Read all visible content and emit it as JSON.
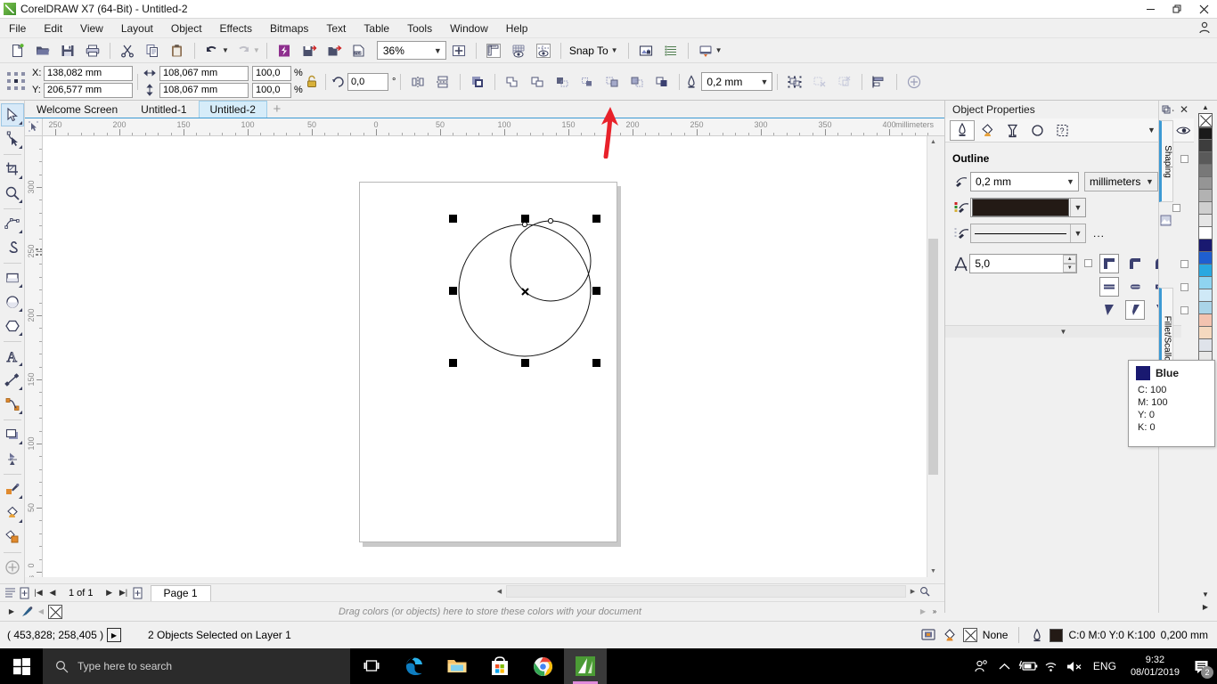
{
  "window": {
    "title": "CorelDRAW X7 (64-Bit) - Untitled-2",
    "minimize": "–",
    "restore": "❐",
    "close": "✕"
  },
  "menubar": {
    "items": [
      {
        "label": "File",
        "accel": "F"
      },
      {
        "label": "Edit",
        "accel": "E"
      },
      {
        "label": "View",
        "accel": "V"
      },
      {
        "label": "Layout",
        "accel": "L"
      },
      {
        "label": "Object",
        "accel": "O"
      },
      {
        "label": "Effects",
        "accel": "c"
      },
      {
        "label": "Bitmaps",
        "accel": "B"
      },
      {
        "label": "Text",
        "accel": "T"
      },
      {
        "label": "Table",
        "accel": "T"
      },
      {
        "label": "Tools",
        "accel": "o"
      },
      {
        "label": "Window",
        "accel": "W"
      },
      {
        "label": "Help",
        "accel": "H"
      }
    ],
    "account_icon": "user-account-icon"
  },
  "standard_toolbar": {
    "buttons": [
      {
        "name": "new-document-button",
        "icon": "new-document-icon"
      },
      {
        "name": "open-button",
        "icon": "open-folder-icon"
      },
      {
        "name": "save-button",
        "icon": "floppy-save-icon"
      },
      {
        "name": "print-button",
        "icon": "printer-icon"
      },
      {
        "name": "cut-button",
        "icon": "scissors-icon"
      },
      {
        "name": "copy-button",
        "icon": "copy-icon"
      },
      {
        "name": "paste-button",
        "icon": "paste-icon"
      },
      {
        "name": "undo-button",
        "icon": "undo-arrow-icon"
      },
      {
        "name": "redo-button",
        "icon": "redo-arrow-icon"
      },
      {
        "name": "import-corel-button",
        "icon": "corel-connect-icon"
      },
      {
        "name": "import-button",
        "icon": "import-icon"
      },
      {
        "name": "export-button",
        "icon": "export-icon"
      },
      {
        "name": "publish-pdf-button",
        "icon": "pdf-export-icon"
      }
    ],
    "zoom_level": "36%",
    "full_screen_label": "full-screen-preview-icon",
    "show_rulers_label": "show-rulers-icon",
    "show_grid_label": "show-grid-icon",
    "show_guides_label": "show-guides-icon",
    "snap_to_label": "Snap To",
    "options_label": "options-icon",
    "object_manager_label": "object-manager-icon",
    "app_launcher_label": "application-launcher-icon"
  },
  "property_bar": {
    "anchor_label": "object-origin-anchor",
    "x_label": "X:",
    "x_value": "138,082 mm",
    "y_label": "Y:",
    "y_value": "206,577 mm",
    "width_value": "108,067 mm",
    "height_value": "108,067 mm",
    "scale_x": "100,0",
    "scale_y": "100,0",
    "percent": "%",
    "lock_ratio_icon": "lock-ratio-icon",
    "rotate_value": "0,0",
    "degree_symbol": "°",
    "mirror_h_icon": "mirror-horizontal-icon",
    "mirror_v_icon": "mirror-vertical-icon",
    "to_front_icon": "order-to-front-icon",
    "weld_icon": "weld-icon",
    "trim_icon": "trim-icon",
    "intersect_icon": "intersect-icon",
    "simplify_icon": "simplify-icon",
    "front_minus_back_icon": "front-minus-back-icon",
    "back_minus_front_icon": "back-minus-front-icon",
    "boundary_icon": "create-boundary-icon",
    "outline_width_icon": "outline-pen-icon",
    "outline_width": "0,2 mm",
    "group_icon": "group-icon",
    "ungroup_icon": "ungroup-icon",
    "ungroup_all_icon": "ungroup-all-icon",
    "align_icon": "align-and-distribute-icon",
    "options_plus_icon": "options-plus-icon"
  },
  "document_tabs": {
    "tabs": [
      {
        "label": "Welcome Screen",
        "active": false
      },
      {
        "label": "Untitled-1",
        "active": false
      },
      {
        "label": "Untitled-2",
        "active": true
      }
    ],
    "add_label": "+"
  },
  "toolbox": {
    "tools": [
      {
        "name": "pick-tool",
        "icon": "arrow-cursor-icon",
        "active": true,
        "flyout": true
      },
      {
        "name": "shape-tool",
        "icon": "shape-node-icon",
        "active": false,
        "flyout": true
      },
      {
        "name": "crop-tool",
        "icon": "crop-icon",
        "active": false,
        "flyout": true
      },
      {
        "name": "zoom-tool",
        "icon": "magnifier-icon",
        "active": false,
        "flyout": true
      },
      {
        "name": "freehand-tool",
        "icon": "freehand-curve-icon",
        "active": false,
        "flyout": true
      },
      {
        "name": "smart-fill-tool",
        "icon": "smart-drawing-icon",
        "active": false,
        "flyout": false
      },
      {
        "name": "rectangle-tool",
        "icon": "rectangle-icon",
        "active": false,
        "flyout": true
      },
      {
        "name": "ellipse-tool",
        "icon": "ellipse-icon",
        "active": false,
        "flyout": true
      },
      {
        "name": "polygon-tool",
        "icon": "polygon-icon",
        "active": false,
        "flyout": true
      },
      {
        "name": "text-tool",
        "icon": "text-a-icon",
        "active": false,
        "flyout": true
      },
      {
        "name": "parallel-dimension",
        "icon": "dimension-icon",
        "active": false,
        "flyout": true
      },
      {
        "name": "connector-tool",
        "icon": "connector-icon",
        "active": false,
        "flyout": true
      },
      {
        "name": "drop-shadow-tool",
        "icon": "drop-shadow-icon",
        "active": false,
        "flyout": true
      },
      {
        "name": "transparency-tool",
        "icon": "transparency-icon",
        "active": false,
        "flyout": false
      },
      {
        "name": "color-eyedropper-tool",
        "icon": "eyedropper-icon",
        "active": false,
        "flyout": true
      },
      {
        "name": "interactive-fill-tool",
        "icon": "fill-bucket-icon",
        "active": false,
        "flyout": true
      },
      {
        "name": "outline-tool",
        "icon": "outline-pen-tool-icon",
        "active": false,
        "flyout": false
      },
      {
        "name": "quick-customize",
        "icon": "plus-circle-icon",
        "active": false,
        "flyout": false
      }
    ]
  },
  "rulers": {
    "unit": "millimeters",
    "h_labels": [
      "250",
      "200",
      "150",
      "100",
      "50",
      "0",
      "50",
      "100",
      "150",
      "200",
      "250",
      "300",
      "350",
      "400"
    ],
    "v_labels": [
      "300",
      "250",
      "200",
      "150",
      "100",
      "50",
      "0"
    ]
  },
  "canvas": {
    "selection_handles": 8,
    "objects": "2 ellipses selected",
    "center_marker": "selection-center-x"
  },
  "docker": {
    "title": "Object Properties",
    "collapse_icon": "collapse-docker-icon",
    "close_icon": "close-docker-icon",
    "tabs": [
      {
        "name": "outline-tab",
        "icon": "outline-pen-icon",
        "active": true
      },
      {
        "name": "fill-tab",
        "icon": "fill-bucket-icon",
        "active": false
      },
      {
        "name": "transparency-tab",
        "icon": "transparency-glass-icon",
        "active": false
      },
      {
        "name": "ellipse-tab",
        "icon": "ellipse-icon",
        "active": false
      },
      {
        "name": "summary-tab",
        "icon": "object-summary-icon",
        "active": false
      }
    ],
    "eye_icon": "visibility-eye-icon",
    "section_title": "Outline",
    "width_value": "0,2 mm",
    "units_value": "millimeters",
    "color_swatch": "#231a15",
    "line_style_label": "solid-line-style",
    "more_label": "...",
    "miter_limit_value": "5,0",
    "miter_icon": "miter-limit-icon",
    "corner_rows": [
      {
        "name": "corner-style-row",
        "buttons": [
          "miter-corner",
          "round-corner",
          "bevel-corner"
        ],
        "selected": 0
      },
      {
        "name": "line-cap-row",
        "buttons": [
          "butt-cap",
          "round-cap",
          "square-cap"
        ],
        "selected": 0
      },
      {
        "name": "line-arrow-row",
        "buttons": [
          "behind-fill-off",
          "scale-with-object",
          "outline-option"
        ],
        "selected": 1
      }
    ],
    "side_tabs": [
      {
        "label": "Shaping"
      },
      {
        "label": "Fillet/Scallop/Chamfer"
      }
    ]
  },
  "color_tooltip": {
    "name": "Blue",
    "swatch": "#191970",
    "values": [
      "C: 100",
      "M: 100",
      "Y: 0",
      "K: 0"
    ]
  },
  "palette": {
    "swatches": [
      "#ffffff",
      "#000000",
      "#1a1a1a",
      "#333333",
      "#4d4d4d",
      "#666666",
      "#808080",
      "#999999",
      "#b3b3b3",
      "#cccccc",
      "#e6e6e6",
      "#f2f2f2",
      "#191970",
      "#0000ff",
      "#00a2e8",
      "#00c0f0",
      "#99d9ea",
      "#c3f0f7",
      "#3f48cc",
      "#7092be",
      "#b97a57",
      "#ff7f27",
      "#ffaec9",
      "#ff0000"
    ],
    "no_color_label": "no-color-swatch"
  },
  "page_nav": {
    "first_label": "|◀",
    "prev_label": "◀",
    "count_label": "1 of 1",
    "next_label": "▶",
    "last_label": "▶|",
    "add_page_before": "add-page-before-icon",
    "add_page_after": "add-page-after-icon",
    "page_tab": "Page 1"
  },
  "color_dropbar": {
    "hint": "Drag colors (or objects) here to store these colors with your document",
    "no_color_icon": "no-color-icon",
    "eyedropper_icon": "eyedropper-icon"
  },
  "status_bar": {
    "coordinates": "( 453,828; 258,405 )",
    "nav_icon": "next-object-icon",
    "selection_info": "2 Objects Selected on Layer 1",
    "color_proof_icon": "color-proof-icon",
    "fill_icon": "fill-bucket-icon",
    "fill_value": "None",
    "outline_icon": "outline-pen-icon",
    "outline_swatch": "#231a15",
    "outline_value": "C:0 M:0 Y:0 K:100",
    "outline_width": "0,200 mm"
  },
  "taskbar": {
    "start_label": "start-windows-icon",
    "search_placeholder": "Type here to search",
    "apps": [
      {
        "name": "task-view-button",
        "icon": "task-view-icon",
        "active": false
      },
      {
        "name": "edge-button",
        "icon": "edge-browser-icon",
        "active": false
      },
      {
        "name": "file-explorer-button",
        "icon": "folder-icon",
        "active": false
      },
      {
        "name": "store-button",
        "icon": "microsoft-store-icon",
        "active": false
      },
      {
        "name": "chrome-button",
        "icon": "chrome-icon",
        "active": false
      },
      {
        "name": "coreldraw-button",
        "icon": "coreldraw-icon",
        "active": true
      }
    ],
    "tray": {
      "people_icon": "people-icon",
      "chevron_icon": "show-hidden-icons-icon",
      "battery_icon": "battery-charging-icon",
      "wifi_icon": "wifi-icon",
      "volume_icon": "volume-muted-icon",
      "language": "ENG",
      "time": "9:32",
      "date": "08/01/2019",
      "notification_icon": "action-center-icon",
      "notification_count": "2"
    }
  }
}
